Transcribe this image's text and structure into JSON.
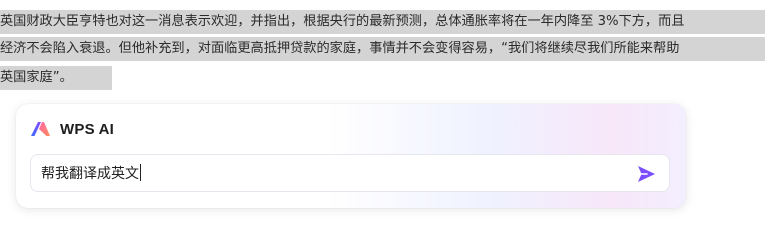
{
  "document": {
    "lines": [
      "英国财政大臣亨特也对这一消息表示欢迎，并指出，根据央行的最新预测，总体通胀率将在一年内降至 3%下方，而且",
      "经济不会陷入衰退。但他补充到，对面临更高抵押贷款的家庭，事情并不会变得容易，“我们将继续尽我们所能来帮助",
      "英国家庭”。"
    ]
  },
  "assistant": {
    "title": "WPS AI",
    "logo_icon": "wps-ai-logo-icon",
    "input_value": "帮我翻译成英文",
    "send_icon": "send-arrow-icon",
    "accent_color": "#7b4dff"
  }
}
